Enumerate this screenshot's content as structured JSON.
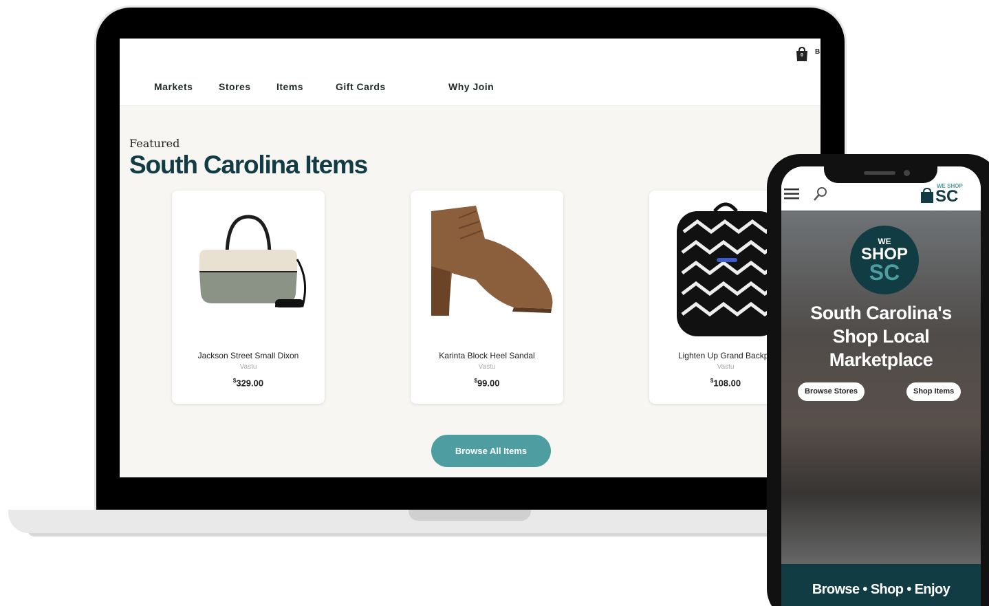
{
  "desktop": {
    "nav": [
      "Markets",
      "Stores",
      "Items",
      "Gift Cards",
      "Why Join"
    ],
    "cart_count": "0",
    "cart_edge_text": "B",
    "featured_label": "Featured",
    "section_title": "South Carolina Items",
    "products": [
      {
        "name": "Jackson Street Small Dixon",
        "brand": "Vastu",
        "currency": "$",
        "price": "329.00"
      },
      {
        "name": "Karinta Block Heel Sandal",
        "brand": "Vastu",
        "currency": "$",
        "price": "99.00"
      },
      {
        "name": "Lighten Up Grand Backpa",
        "brand": "Vastu",
        "currency": "$",
        "price": "108.00"
      }
    ],
    "browse_all_label": "Browse All Items"
  },
  "mobile": {
    "logo_small_text": "WE SHOP",
    "logo_text": "SC",
    "badge": {
      "we": "WE",
      "shop": "SHOP",
      "sc": "SC"
    },
    "headline": [
      "South Carolina's",
      "Shop Local",
      "Marketplace"
    ],
    "browse_stores_label": "Browse Stores",
    "shop_items_label": "Shop Items",
    "footer_text": "Browse • Shop • Enjoy"
  },
  "colors": {
    "brand_dark": "#123c44",
    "brand_teal": "#4e9da1",
    "page_bg": "#f7f6f2"
  }
}
